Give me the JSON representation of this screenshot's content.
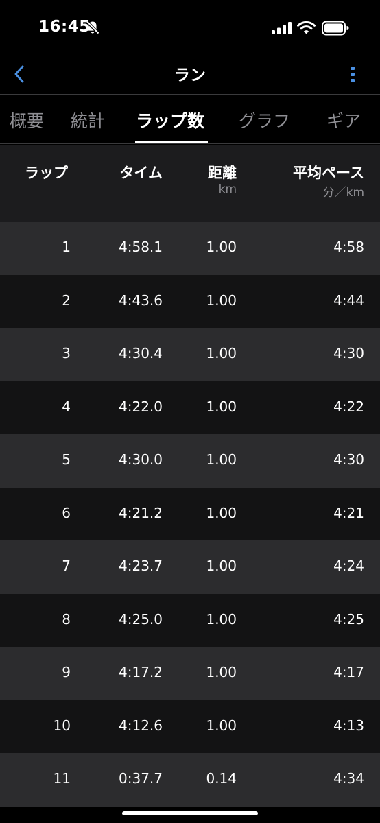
{
  "status_bar": {
    "time": "16:45"
  },
  "nav": {
    "title": "ラン"
  },
  "tabs": [
    {
      "label": "概要"
    },
    {
      "label": "統計"
    },
    {
      "label": "ラップ数",
      "active": true
    },
    {
      "label": "グラフ"
    },
    {
      "label": "ギア"
    }
  ],
  "table": {
    "headers": {
      "lap": "ラップ",
      "time": "タイム",
      "distance": "距離",
      "distance_unit": "km",
      "pace": "平均ペース",
      "pace_unit": "分／km"
    },
    "rows": [
      {
        "lap": "1",
        "time": "4:58.1",
        "distance": "1.00",
        "pace": "4:58"
      },
      {
        "lap": "2",
        "time": "4:43.6",
        "distance": "1.00",
        "pace": "4:44"
      },
      {
        "lap": "3",
        "time": "4:30.4",
        "distance": "1.00",
        "pace": "4:30"
      },
      {
        "lap": "4",
        "time": "4:22.0",
        "distance": "1.00",
        "pace": "4:22"
      },
      {
        "lap": "5",
        "time": "4:30.0",
        "distance": "1.00",
        "pace": "4:30"
      },
      {
        "lap": "6",
        "time": "4:21.2",
        "distance": "1.00",
        "pace": "4:21"
      },
      {
        "lap": "7",
        "time": "4:23.7",
        "distance": "1.00",
        "pace": "4:24"
      },
      {
        "lap": "8",
        "time": "4:25.0",
        "distance": "1.00",
        "pace": "4:25"
      },
      {
        "lap": "9",
        "time": "4:17.2",
        "distance": "1.00",
        "pace": "4:17"
      },
      {
        "lap": "10",
        "time": "4:12.6",
        "distance": "1.00",
        "pace": "4:13"
      },
      {
        "lap": "11",
        "time": "0:37.7",
        "distance": "0.14",
        "pace": "4:34"
      }
    ]
  },
  "icons": {
    "back": "chevron-left-icon",
    "more": "more-vertical-icon",
    "bell": "bell-slash-icon",
    "signal": "cellular-signal-icon",
    "wifi": "wifi-icon",
    "battery": "battery-icon"
  },
  "colors": {
    "accent": "#4a90e2",
    "background": "#000000",
    "row_light": "#2c2c2e",
    "row_dark": "#131314",
    "muted": "#8e8e93"
  }
}
